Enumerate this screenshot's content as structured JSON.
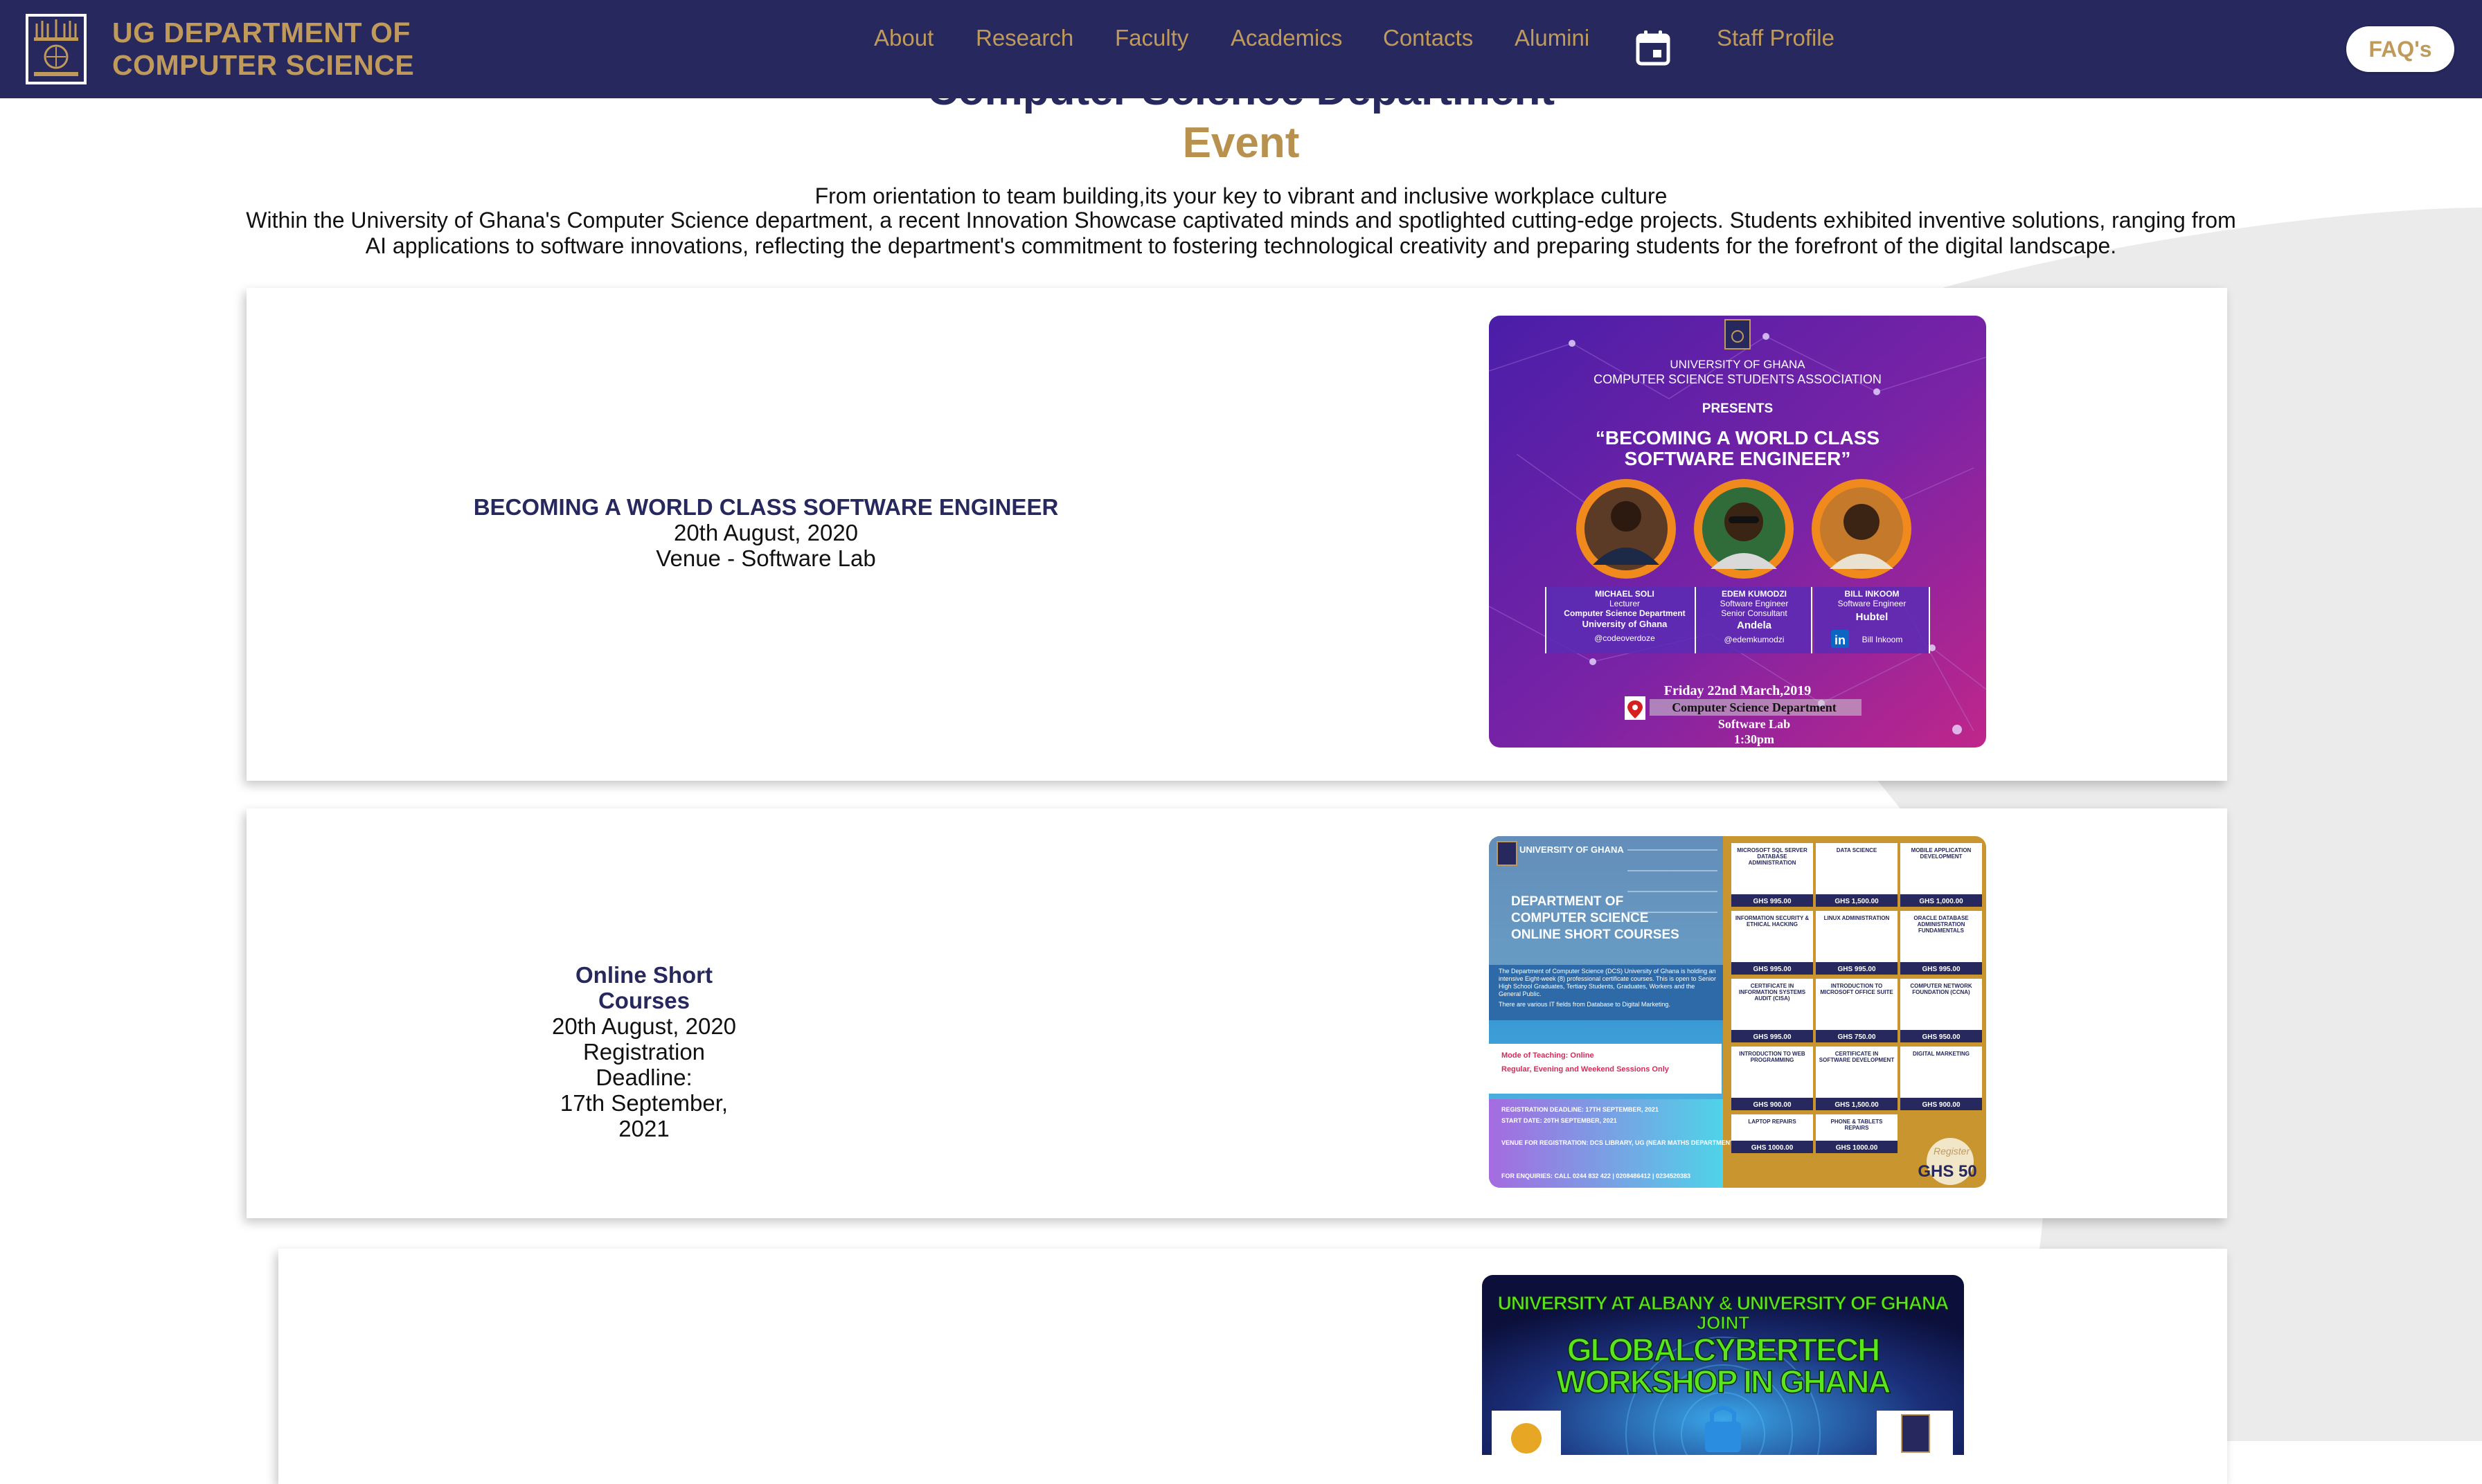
{
  "nav": {
    "brand_line1": "UG DEPARTMENT OF",
    "brand_line2": "COMPUTER SCIENCE",
    "links": [
      "About",
      "Research",
      "Faculty",
      "Academics",
      "Contacts",
      "Alumini"
    ],
    "calendar_icon": "calendar-icon",
    "staff_profile": "Staff Profile",
    "faq": "FAQ's"
  },
  "header": {
    "title": "Computer Science Department",
    "subtitle": "Event",
    "tagline": "From orientation to team building,its your key to vibrant and inclusive workplace culture",
    "intro": "Within the University of Ghana's Computer Science department, a recent Innovation Showcase captivated minds and spotlighted cutting-edge projects. Students exhibited inventive solutions, ranging from AI applications to software innovations, reflecting the department's commitment to fostering technological creativity and preparing students for the forefront of the digital landscape."
  },
  "events": [
    {
      "title": "BECOMING A WORLD CLASS SOFTWARE ENGINEER",
      "date": "20th August, 2020",
      "detail": "Venue - Software Lab",
      "poster": {
        "org_line1": "UNIVERSITY OF GHANA",
        "org_line2": "COMPUTER SCIENCE STUDENTS ASSOCIATION",
        "presents": "PRESENTS",
        "headline_line1": "“BECOMING A WORLD CLASS",
        "headline_line2": "SOFTWARE ENGINEER”",
        "speakers": [
          {
            "name": "MICHAEL SOLI",
            "role1": "Lecturer",
            "role2": "Computer Science Department",
            "org": "University of Ghana",
            "handle": "@codeoverdoze"
          },
          {
            "name": "EDEM KUMODZI",
            "role1": "Software Engineer",
            "role2": "Senior Consultant",
            "org": "Andela",
            "handle": "@edemkumodzi"
          },
          {
            "name": "BILL INKOOM",
            "role1": "Software Engineer",
            "role2": "Hubtel",
            "org": "",
            "handle": "Bill Inkoom"
          }
        ],
        "date": "Friday 22nd March,2019",
        "venue1": "Computer Science Department",
        "venue2": "Software Lab",
        "time": "1:30pm"
      }
    },
    {
      "title": "Online Short Courses",
      "date": "20th August, 2020",
      "detail": "Registration Deadline:",
      "detail2": "17th September, 2021",
      "poster": {
        "uni": "UNIVERSITY OF GHANA",
        "heading1": "DEPARTMENT OF",
        "heading2": "COMPUTER SCIENCE",
        "heading3": "ONLINE SHORT COURSES",
        "blurb": "The Department of Computer Science (DCS) University of Ghana is holding an intensive Eight-week (8) professional certificate courses. This is open to Senior High School Graduates, Tertiary Students, Graduates, Workers and the General Public.",
        "blurb2": "There are various IT fields from Database to Digital Marketing.",
        "mode_label": "Mode of Teaching: Online",
        "mode_sessions": "Regular, Evening and Weekend Sessions Only",
        "reg_deadline": "REGISTRATION DEADLINE: 17TH SEPTEMBER, 2021",
        "start_date": "START DATE: 20TH SEPTEMBER, 2021",
        "venue": "VENUE FOR REGISTRATION: DCS LIBRARY, UG (NEAR MATHS DEPARTMENT)",
        "enquiries": "FOR ENQUIRIES: CALL 0244 832 422 | 0208486412 | 0234520383",
        "courses": [
          {
            "name": "MICROSOFT SQL SERVER DATABASE ADMINISTRATION",
            "price": "GHS 995.00"
          },
          {
            "name": "DATA SCIENCE",
            "price": "GHS 1,500.00"
          },
          {
            "name": "MOBILE APPLICATION DEVELOPMENT",
            "price": "GHS 1,000.00"
          },
          {
            "name": "INFORMATION SECURITY & ETHICAL HACKING",
            "price": "GHS 995.00"
          },
          {
            "name": "LINUX ADMINISTRATION",
            "price": "GHS 995.00"
          },
          {
            "name": "ORACLE DATABASE ADMINISTRATION FUNDAMENTALS",
            "price": "GHS 995.00"
          },
          {
            "name": "CERTIFICATE IN INFORMATION SYSTEMS AUDIT (CISA)",
            "price": "GHS 995.00"
          },
          {
            "name": "INTRODUCTION TO MICROSOFT OFFICE SUITE",
            "price": "GHS 750.00"
          },
          {
            "name": "COMPUTER NETWORK FOUNDATION (CCNA)",
            "price": "GHS 950.00"
          },
          {
            "name": "INTRODUCTION TO WEB PROGRAMMING",
            "price": "GHS 900.00"
          },
          {
            "name": "CERTIFICATE IN SOFTWARE DEVELOPMENT",
            "price": "GHS 1,500.00"
          },
          {
            "name": "DIGITAL MARKETING",
            "price": "GHS 900.00"
          },
          {
            "name": "LAPTOP REPAIRS",
            "price": "GHS 1000.00"
          },
          {
            "name": "PHONE & TABLETS REPAIRS",
            "price": "GHS 1000.00"
          }
        ],
        "register_script": "Register",
        "reg_fee": "GHS 50"
      }
    },
    {
      "poster": {
        "line1": "UNIVERSITY AT ALBANY & UNIVERSITY OF GHANA",
        "line2": "JOINT",
        "line3": "GLOBALCYBERTECH",
        "line4": "WORKSHOP IN GHANA"
      }
    }
  ],
  "colors": {
    "navy": "#26285e",
    "gold": "#c09a5b",
    "event_gold": "#b8914f",
    "purple_poster": "#6a1fa6",
    "green_headline": "#5be51e"
  }
}
